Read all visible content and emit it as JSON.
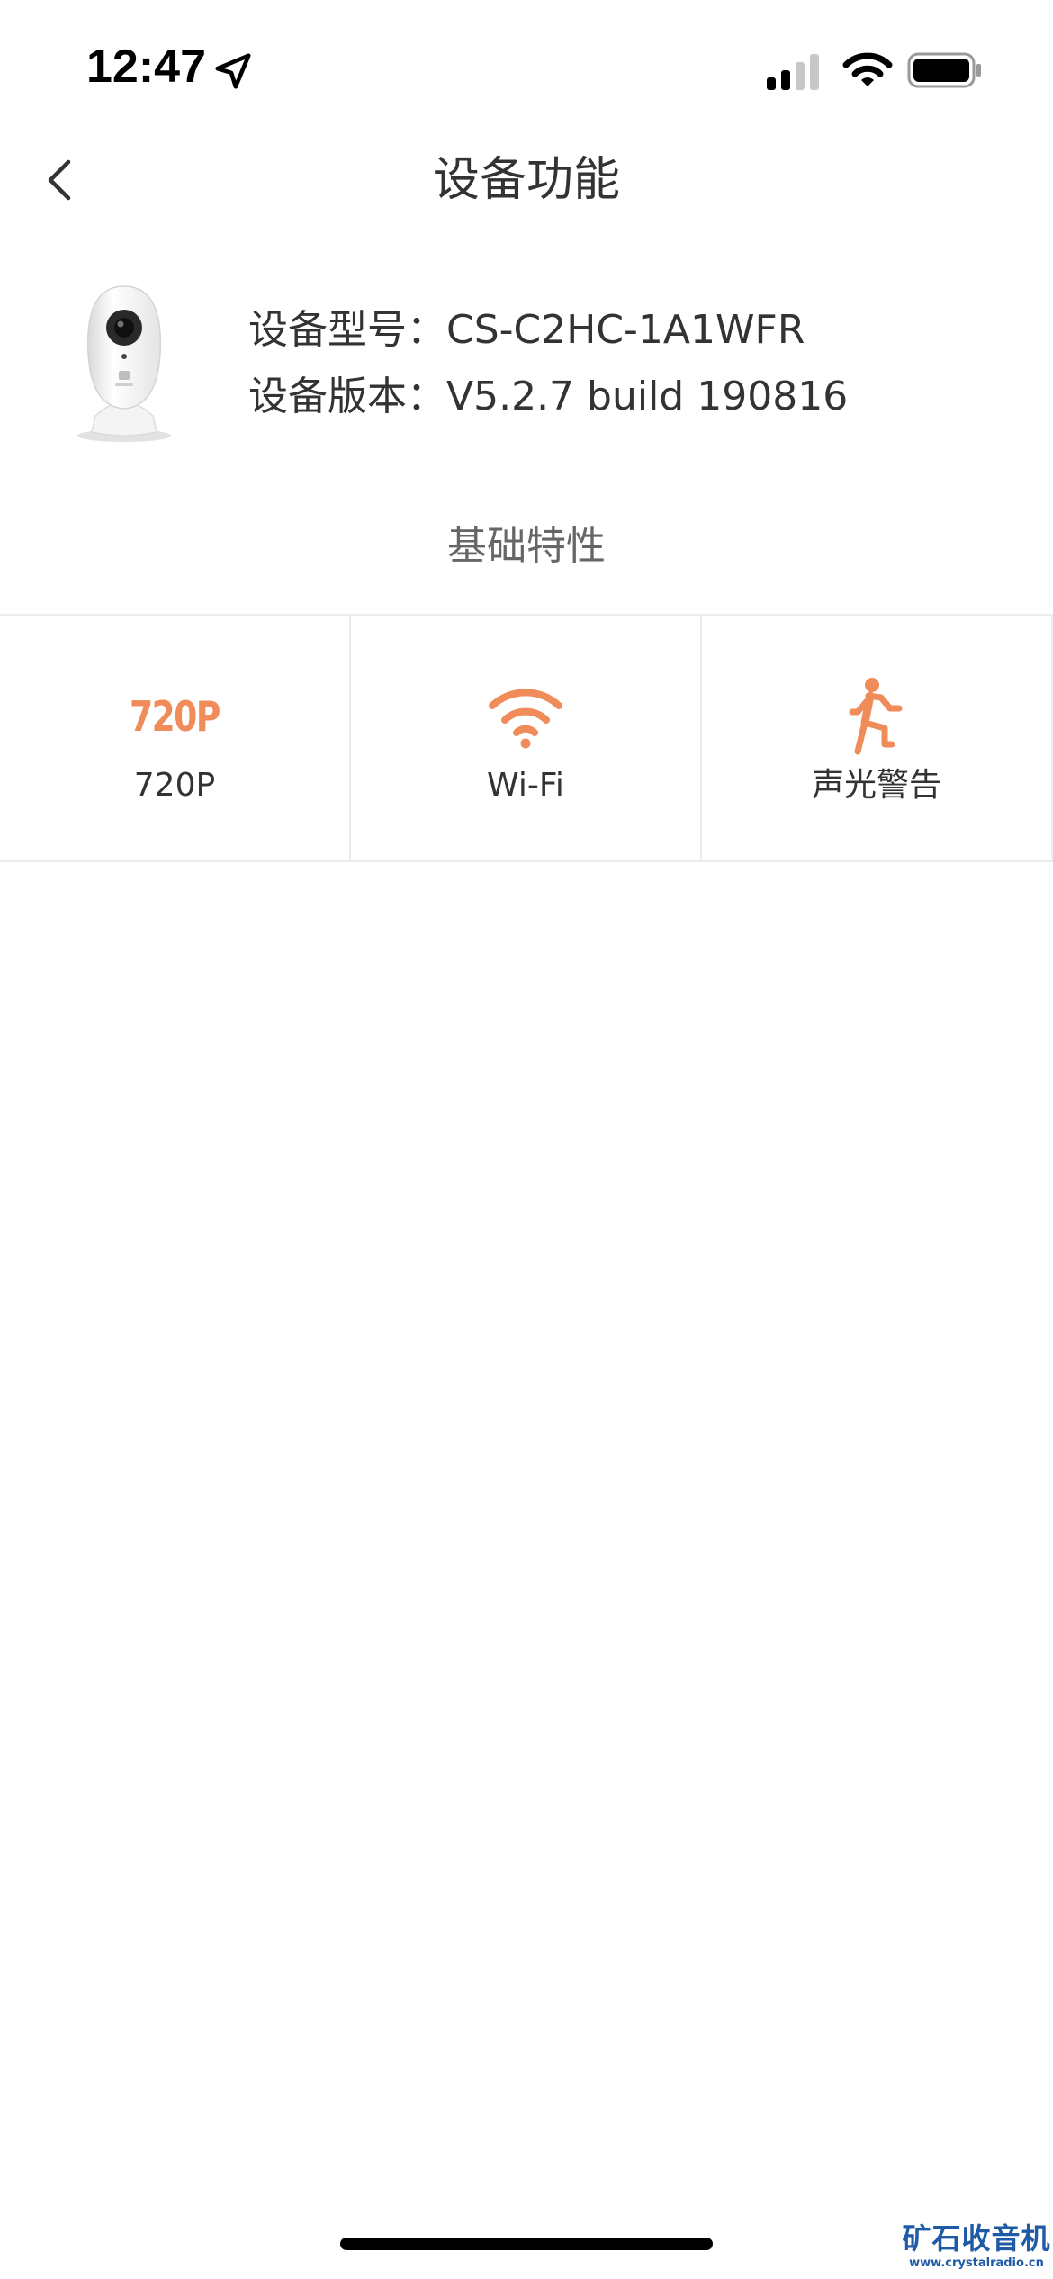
{
  "status_bar": {
    "time": "12:47",
    "icons": [
      "location-arrow-icon",
      "cellular-signal-icon",
      "wifi-icon",
      "battery-icon"
    ]
  },
  "nav": {
    "back_icon": "chevron-left-icon",
    "title": "设备功能"
  },
  "device": {
    "image": "camera-device-image",
    "model_label": "设备型号：",
    "model_value": "CS-C2HC-1A1WFR",
    "version_label": "设备版本：",
    "version_value": "V5.2.7 build 190816"
  },
  "section": {
    "title": "基础特性"
  },
  "features": [
    {
      "icon": "720p-icon",
      "icon_text": "720P",
      "label": "720P"
    },
    {
      "icon": "wifi-icon",
      "label": "Wi-Fi"
    },
    {
      "icon": "running-person-icon",
      "label": "声光警告"
    }
  ],
  "watermark": {
    "line1": "矿石收音机",
    "line2": "www.crystalradio.cn"
  },
  "colors": {
    "accent": "#ef8c5a",
    "text": "#333333",
    "subtext": "#666666",
    "divider": "#ececec",
    "watermark": "#1f5aa6"
  }
}
